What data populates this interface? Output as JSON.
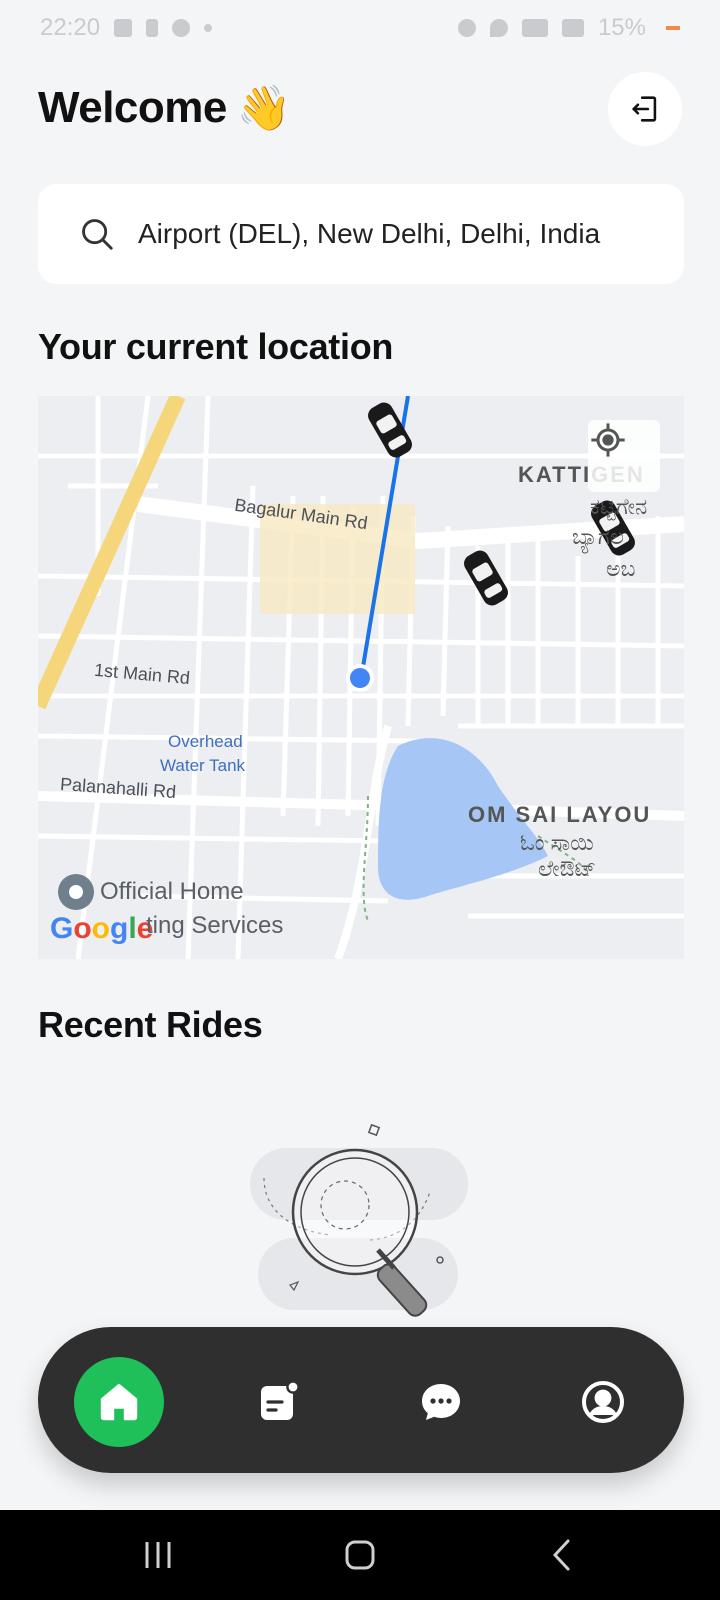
{
  "status_bar": {
    "time": "22:20",
    "battery": "15%"
  },
  "header": {
    "title": "Welcome",
    "wave_emoji": "👋",
    "logout_icon": "logout-icon"
  },
  "search": {
    "value": "Airport (DEL), New Delhi, Delhi, India",
    "icon": "search-icon"
  },
  "sections": {
    "location_title": "Your current location",
    "recent_title": "Recent Rides"
  },
  "map": {
    "labels": {
      "bagalur": "Bagalur Main Rd",
      "first_main": "1st Main Rd",
      "overhead": "Overhead",
      "water_tank": "Water Tank",
      "palanahalli": "Palanahalli Rd",
      "kattigen": "KATTIGEN",
      "kattigen_local_1": "ಕಟ್ಟಿಗೇನ",
      "kattigen_local_2": "ಬ್ಯಾಗಲ",
      "kattigen_local_3": "ಅಬ",
      "om_sai": "OM SAI LAYOU",
      "om_sai_local_1": "ಓಂ ಸಾಯಿ",
      "om_sai_local_2": "ಲೇಔಟ್",
      "official_home": "Official Home",
      "ting_services": "ting Services"
    },
    "google_logo": "Google",
    "colors": {
      "water": "#a6c6f5",
      "highway": "#f6d67a",
      "route": "#1a73e8"
    }
  },
  "bottom_nav": {
    "items": [
      {
        "name": "home",
        "icon": "home-icon",
        "active": true
      },
      {
        "name": "rides",
        "icon": "receipt-icon",
        "active": false
      },
      {
        "name": "chat",
        "icon": "chat-icon",
        "active": false
      },
      {
        "name": "profile",
        "icon": "profile-icon",
        "active": false
      }
    ],
    "active_color": "#1fbf5a"
  }
}
